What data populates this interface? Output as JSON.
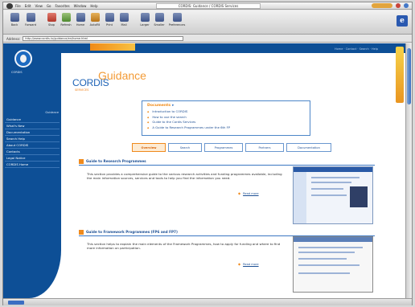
{
  "window": {
    "title": "CORDIS: Guidance / CORDIS Services",
    "menu": [
      "File",
      "Edit",
      "View",
      "Go",
      "Favorites",
      "Window",
      "Help"
    ]
  },
  "toolbar": {
    "buttons": [
      {
        "label": "Back",
        "icon": "back-arrow-icon",
        "color": "b"
      },
      {
        "label": "Forward",
        "icon": "forward-arrow-icon",
        "color": "b"
      },
      {
        "label": "Stop",
        "icon": "stop-icon",
        "color": "r"
      },
      {
        "label": "Refresh",
        "icon": "refresh-icon",
        "color": "g"
      },
      {
        "label": "Home",
        "icon": "home-icon",
        "color": "b"
      },
      {
        "label": "AutoFill",
        "icon": "autofill-icon",
        "color": "o"
      },
      {
        "label": "Print",
        "icon": "print-icon",
        "color": "b"
      },
      {
        "label": "Mail",
        "icon": "mail-icon",
        "color": "b"
      },
      {
        "label": "Larger",
        "icon": "text-larger-icon",
        "color": "b"
      },
      {
        "label": "Smaller",
        "icon": "text-smaller-icon",
        "color": "b"
      },
      {
        "label": "Preferences",
        "icon": "preferences-icon",
        "color": "b"
      }
    ]
  },
  "address": {
    "label": "Address:",
    "value": "http://www.cordis.lu/guidance/en/home.html"
  },
  "site": {
    "logo_text": "CORDIS",
    "brand": "CORDIS",
    "brand_sub": "SERVICES",
    "heading": "Guidance",
    "top_links": "Home · Contact · Search · Help",
    "nav_heading": "Guidance",
    "nav": [
      "Guidance",
      "What's New",
      "Documentation",
      "Search Help",
      "About CORDIS",
      "Contacts",
      "Legal Notice",
      "CORDIS Home"
    ],
    "box": {
      "title": "Documents",
      "links": [
        "Introduction to CORDIS",
        "How to use the search",
        "Guide to the Cordis Services",
        "A Guide to Research Programmes under the 6th FP"
      ]
    },
    "tabs": [
      "Overview",
      "Search",
      "Programmes",
      "Partners",
      "Documentation"
    ],
    "sections": [
      {
        "title": "Guide to Research Programmes",
        "body": "This section provides a comprehensive guide to the various research activities and funding programmes available, including the main information sources, services and tools to help you find the information you need.",
        "more": "Read more"
      },
      {
        "title": "Guide to Framework Programmes (FP6 and FP7)",
        "body": "This section helps to explain the main elements of the Framework Programmes, how to apply for funding and where to find more information on participation.",
        "more": "Read more"
      }
    ]
  },
  "colors": {
    "brand_blue": "#0d4f96",
    "accent_orange": "#f08a17",
    "link_blue": "#1d4e93"
  }
}
